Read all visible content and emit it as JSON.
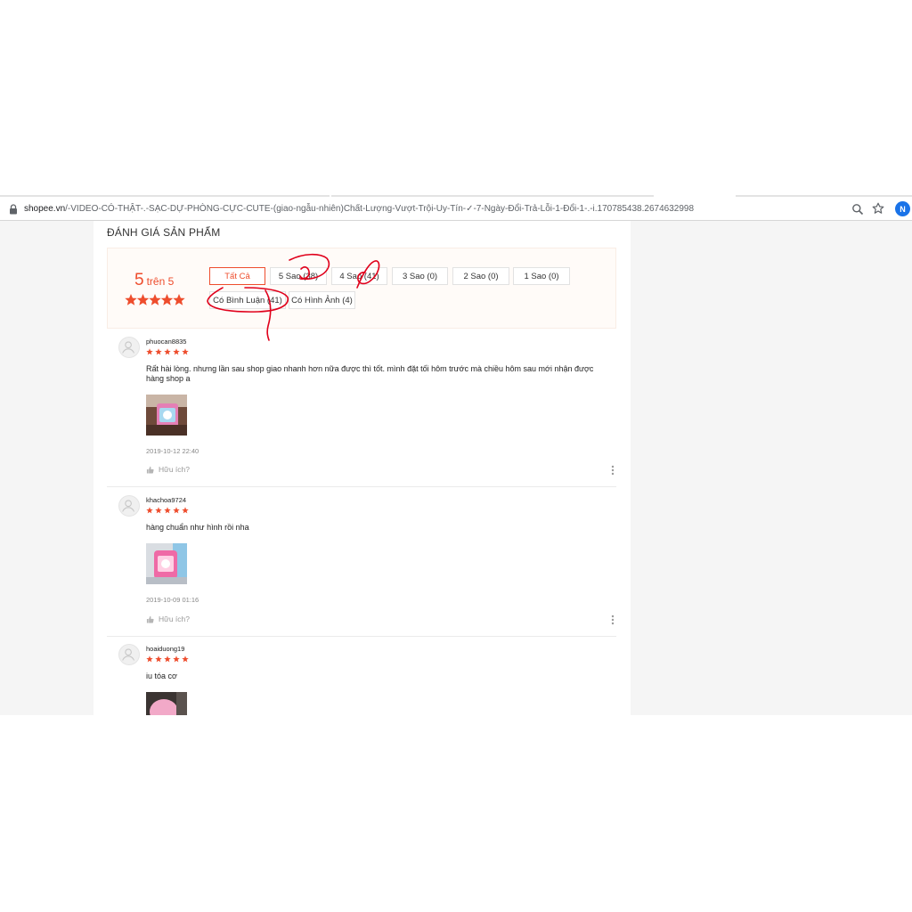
{
  "browser": {
    "url_host": "shopee.vn",
    "url_path": "/-VIDEO-CÓ-THẬT-.-SẠC-DỰ-PHÒNG-CỰC-CUTE-(giao-ngẫu-nhiên)Chất-Lượng-Vượt-Trội-Uy-Tín-✓-7-Ngày-Đổi-Trả-Lỗi-1-Đổi-1-.-i.170785438.2674632998",
    "profile_initial": "N"
  },
  "section_title": "ĐÁNH GIÁ SẢN PHẨM",
  "overview": {
    "score": "5",
    "score_suffix": "trên 5",
    "stars": 5
  },
  "filters": {
    "all": "Tất Cả",
    "five_star": "5 Sao (38)",
    "four_star": "4 Sao (41)",
    "three_star": "3 Sao (0)",
    "two_star": "2 Sao (0)",
    "one_star": "1 Sao (0)",
    "with_comment": "Có Bình Luận (41)",
    "with_image": "Có Hình Ảnh (4)"
  },
  "reviews": [
    {
      "username": "phuocan8835",
      "rating": 5,
      "comment": "Rất hài lòng. nhưng lần sau shop giao nhanh hơn nữa được thì tốt. mình đặt tối hôm trước mà chiều hôm sau mới nhận được hàng shop a",
      "time": "2019-10-12 22:40",
      "helpful": "Hữu ích?"
    },
    {
      "username": "khachoa9724",
      "rating": 5,
      "comment": "hàng chuẩn như hình rồi nha",
      "time": "2019-10-09 01:16",
      "helpful": "Hữu ích?"
    },
    {
      "username": "hoaiduong19",
      "rating": 5,
      "comment": "iu tóa cơ"
    }
  ],
  "colors": {
    "brand": "#ee4d2d",
    "annotation_ink": "#e0001b"
  }
}
